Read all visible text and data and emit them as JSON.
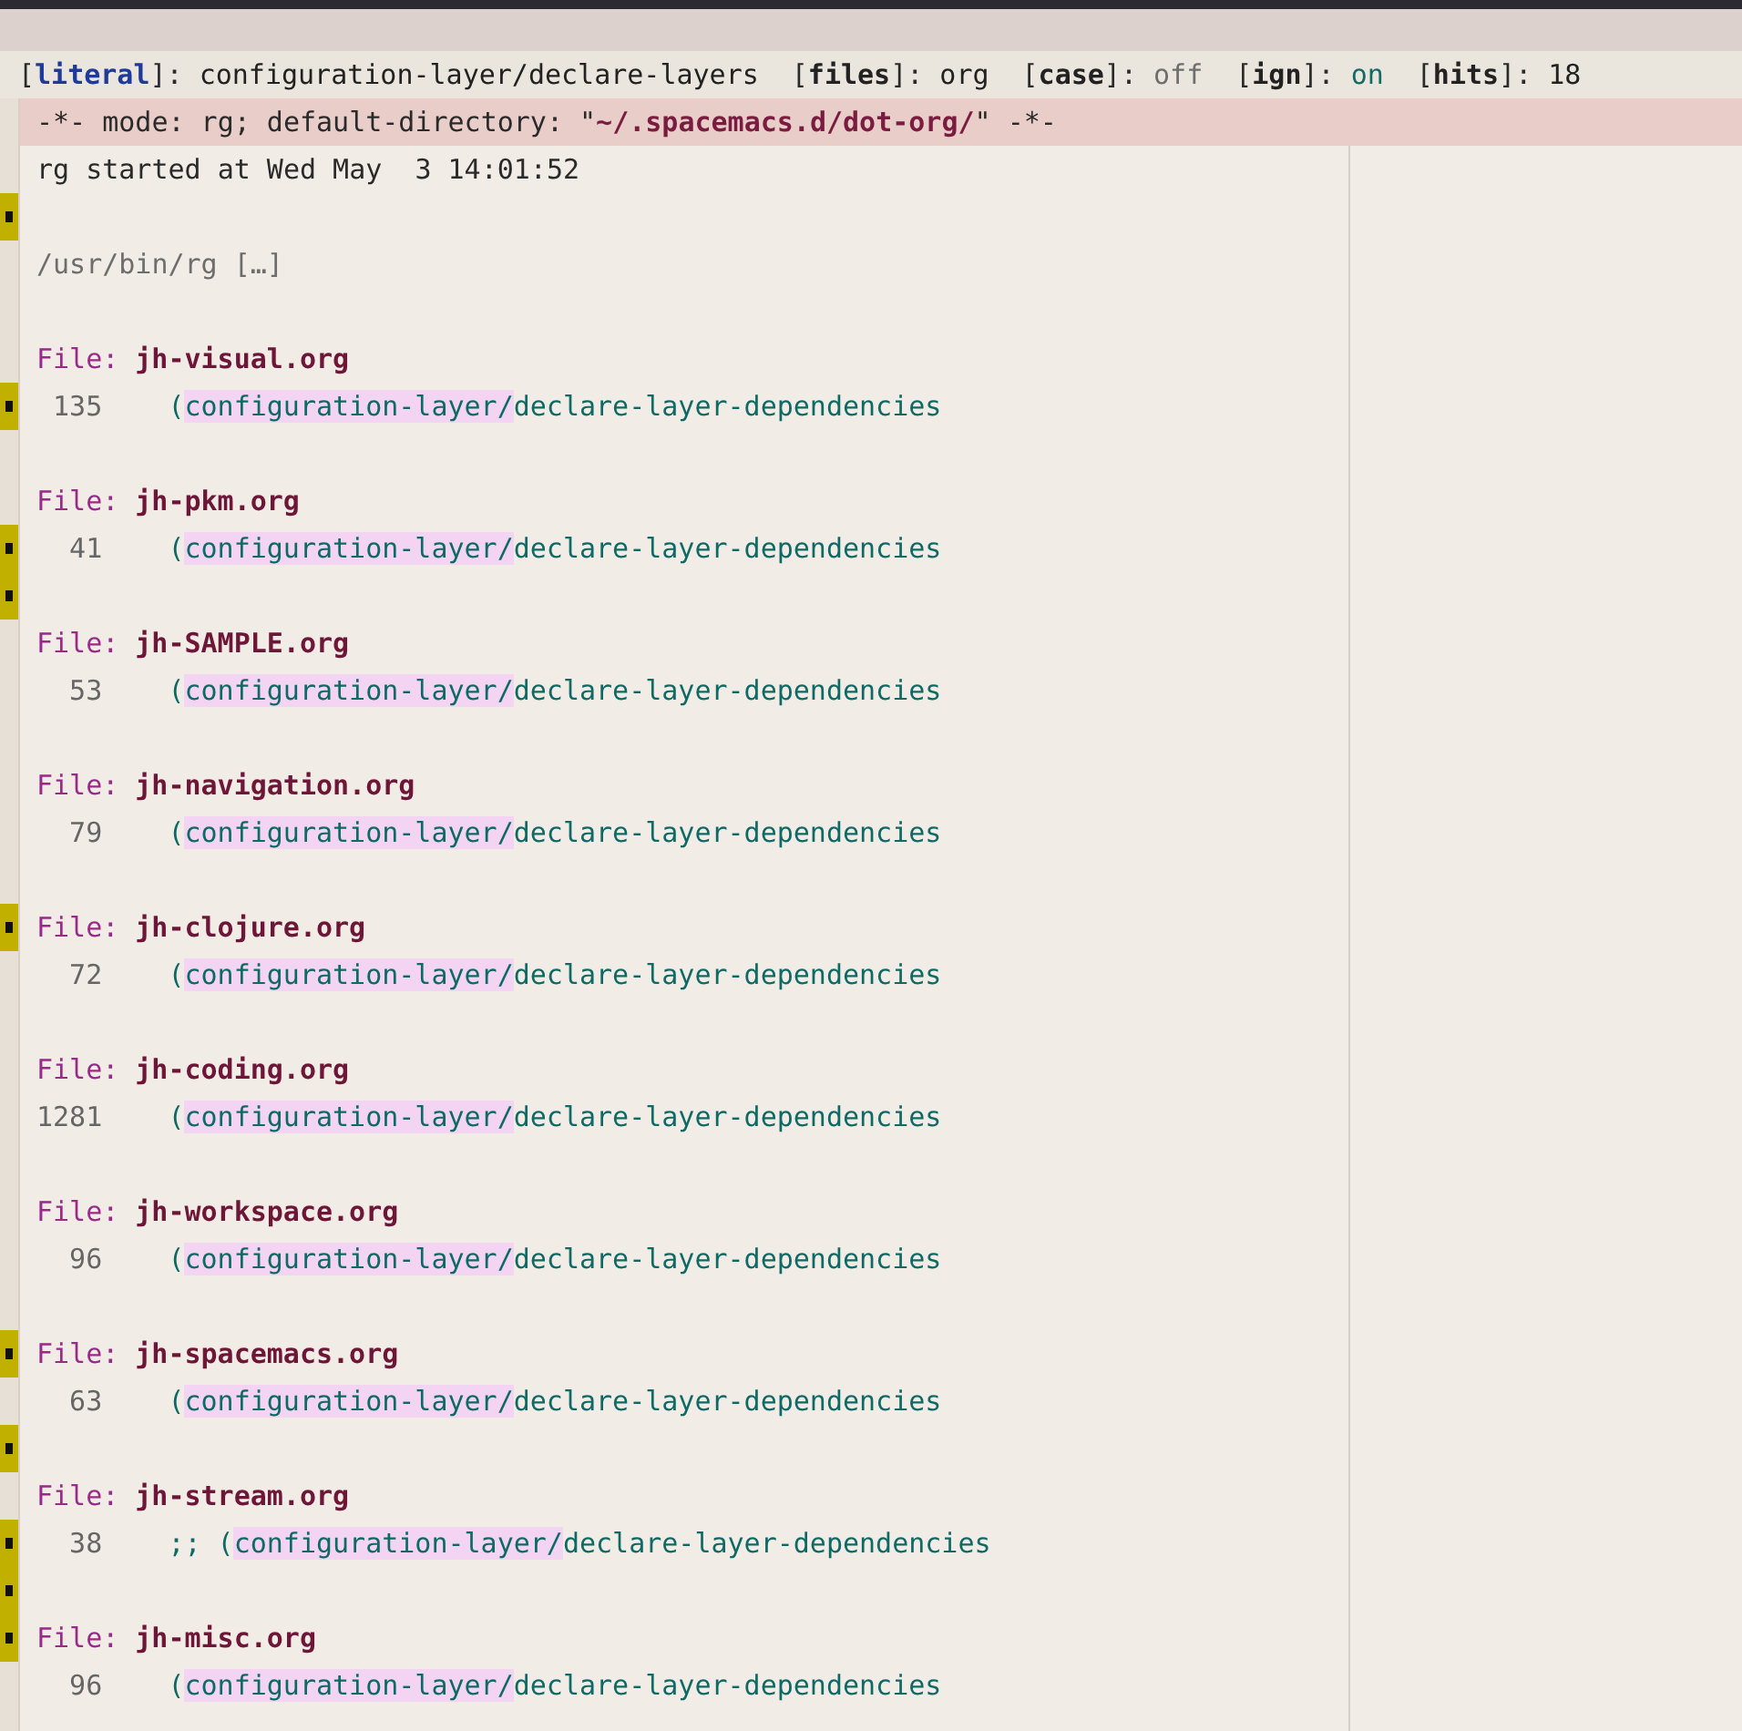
{
  "header": [
    {
      "open": "[",
      "key": "literal",
      "close": "]:",
      "key_accent": true,
      "value": "configuration-layer/declare-layers",
      "kind": "plain"
    },
    {
      "open": "[",
      "key": "files",
      "close": "]:",
      "key_accent": false,
      "value": "org",
      "kind": "plain"
    },
    {
      "open": "[",
      "key": "case",
      "close": "]:",
      "key_accent": false,
      "value": "off",
      "kind": "muted"
    },
    {
      "open": "[",
      "key": "ign",
      "close": "]:",
      "key_accent": false,
      "value": "on",
      "kind": "accent"
    },
    {
      "open": "[",
      "key": "hits",
      "close": "]:",
      "key_accent": false,
      "value": "18",
      "kind": "plain"
    }
  ],
  "lines": [
    {
      "kind": "mode",
      "before": "-*- mode: rg; default-directory: \"",
      "directory": "~/.spacemacs.d/dot-org/",
      "after": "\" -*-",
      "fringe_mark": false
    },
    {
      "kind": "plain",
      "text": "rg started at Wed May  3 14:01:52",
      "fringe_mark": false
    },
    {
      "kind": "blank",
      "fringe_mark": true
    },
    {
      "kind": "command",
      "text": "/usr/bin/rg […]",
      "fringe_mark": false
    },
    {
      "kind": "blank",
      "fringe_mark": false
    },
    {
      "kind": "file",
      "label": "File:",
      "name": "jh-visual.org",
      "fringe_mark": false
    },
    {
      "kind": "match",
      "number": "135",
      "prefix": "(",
      "match": "configuration-layer/",
      "rest": "declare-layer-dependencies",
      "fringe_mark": true
    },
    {
      "kind": "blank",
      "fringe_mark": false
    },
    {
      "kind": "file",
      "label": "File:",
      "name": "jh-pkm.org",
      "fringe_mark": false
    },
    {
      "kind": "match",
      "number": "41",
      "prefix": "(",
      "match": "configuration-layer/",
      "rest": "declare-layer-dependencies",
      "fringe_mark": true
    },
    {
      "kind": "blank",
      "fringe_mark": true
    },
    {
      "kind": "file",
      "label": "File:",
      "name": "jh-SAMPLE.org",
      "fringe_mark": false
    },
    {
      "kind": "match",
      "number": "53",
      "prefix": "(",
      "match": "configuration-layer/",
      "rest": "declare-layer-dependencies",
      "fringe_mark": false
    },
    {
      "kind": "blank",
      "fringe_mark": false
    },
    {
      "kind": "file",
      "label": "File:",
      "name": "jh-navigation.org",
      "fringe_mark": false
    },
    {
      "kind": "match",
      "number": "79",
      "prefix": "(",
      "match": "configuration-layer/",
      "rest": "declare-layer-dependencies",
      "fringe_mark": false
    },
    {
      "kind": "blank",
      "fringe_mark": false
    },
    {
      "kind": "file",
      "label": "File:",
      "name": "jh-clojure.org",
      "fringe_mark": true
    },
    {
      "kind": "match",
      "number": "72",
      "prefix": "(",
      "match": "configuration-layer/",
      "rest": "declare-layer-dependencies",
      "fringe_mark": false
    },
    {
      "kind": "blank",
      "fringe_mark": false
    },
    {
      "kind": "file",
      "label": "File:",
      "name": "jh-coding.org",
      "fringe_mark": false
    },
    {
      "kind": "match",
      "number": "1281",
      "prefix": "(",
      "match": "configuration-layer/",
      "rest": "declare-layer-dependencies",
      "fringe_mark": false
    },
    {
      "kind": "blank",
      "fringe_mark": false
    },
    {
      "kind": "file",
      "label": "File:",
      "name": "jh-workspace.org",
      "fringe_mark": false
    },
    {
      "kind": "match",
      "number": "96",
      "prefix": "(",
      "match": "configuration-layer/",
      "rest": "declare-layer-dependencies",
      "fringe_mark": false
    },
    {
      "kind": "blank",
      "fringe_mark": false
    },
    {
      "kind": "file",
      "label": "File:",
      "name": "jh-spacemacs.org",
      "fringe_mark": true
    },
    {
      "kind": "match",
      "number": "63",
      "prefix": "(",
      "match": "configuration-layer/",
      "rest": "declare-layer-dependencies",
      "fringe_mark": false
    },
    {
      "kind": "blank",
      "fringe_mark": true
    },
    {
      "kind": "file",
      "label": "File:",
      "name": "jh-stream.org",
      "fringe_mark": false
    },
    {
      "kind": "match",
      "number": "38",
      "prefix": ";; (",
      "match": "configuration-layer/",
      "rest": "declare-layer-dependencies",
      "fringe_mark": true
    },
    {
      "kind": "blank",
      "fringe_mark": true
    },
    {
      "kind": "file",
      "label": "File:",
      "name": "jh-misc.org",
      "fringe_mark": true
    },
    {
      "kind": "match",
      "number": "96",
      "prefix": "(",
      "match": "configuration-layer/",
      "rest": "declare-layer-dependencies",
      "fringe_mark": false
    }
  ]
}
